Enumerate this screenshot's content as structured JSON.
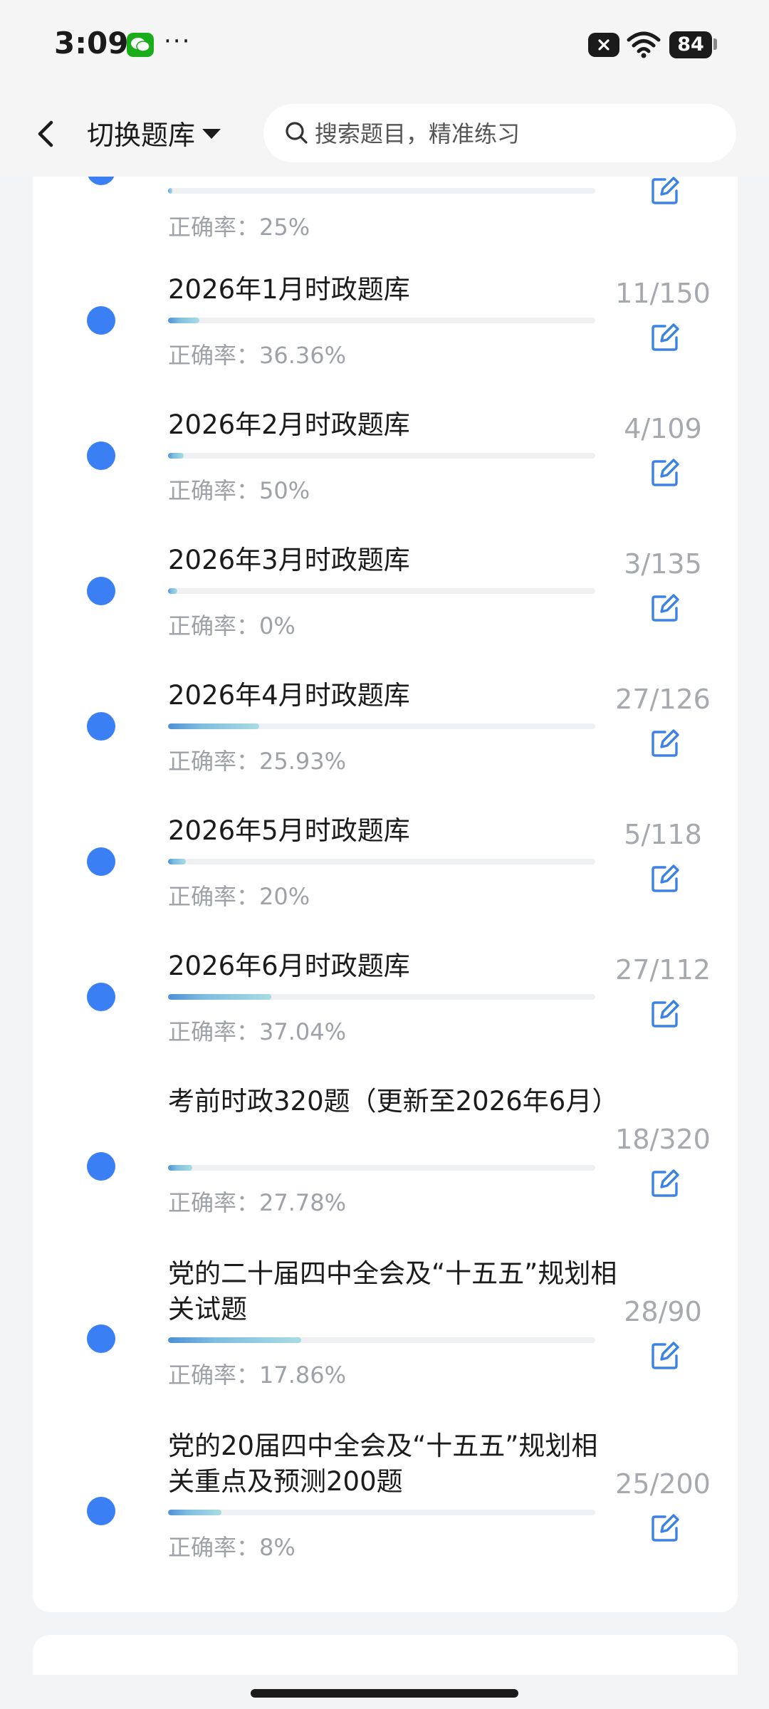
{
  "status_bar": {
    "time": "3:09",
    "dots": "···",
    "battery": "84"
  },
  "header": {
    "switch_label": "切换题库",
    "search_placeholder": "搜索题目，精准练习"
  },
  "top_partial": {
    "accuracy": "正确率：25%",
    "progress": 0.01
  },
  "items": [
    {
      "title": "2026年1月时政题库",
      "count": "11/150",
      "accuracy": "正确率：36.36%",
      "progress": 0.073
    },
    {
      "title": "2026年2月时政题库",
      "count": "4/109",
      "accuracy": "正确率：50%",
      "progress": 0.037
    },
    {
      "title": "2026年3月时政题库",
      "count": "3/135",
      "accuracy": "正确率：0%",
      "progress": 0.022
    },
    {
      "title": "2026年4月时政题库",
      "count": "27/126",
      "accuracy": "正确率：25.93%",
      "progress": 0.214
    },
    {
      "title": "2026年5月时政题库",
      "count": "5/118",
      "accuracy": "正确率：20%",
      "progress": 0.042
    },
    {
      "title": "2026年6月时政题库",
      "count": "27/112",
      "accuracy": "正确率：37.04%",
      "progress": 0.241
    },
    {
      "title": "考前时政320题（更新至2026年6月）",
      "count": "18/320",
      "accuracy": "正确率：27.78%",
      "progress": 0.056
    },
    {
      "title": "党的二十届四中全会及“十五五”规划相关试题",
      "count": "28/90",
      "accuracy": "正确率：17.86%",
      "progress": 0.311
    },
    {
      "title": "党的20届四中全会及“十五五”规划相关重点及预测200题",
      "count": "25/200",
      "accuracy": "正确率：8%",
      "progress": 0.125
    }
  ],
  "colors": {
    "accent": "#3b7ff5",
    "edit_icon": "#3b82e8"
  }
}
